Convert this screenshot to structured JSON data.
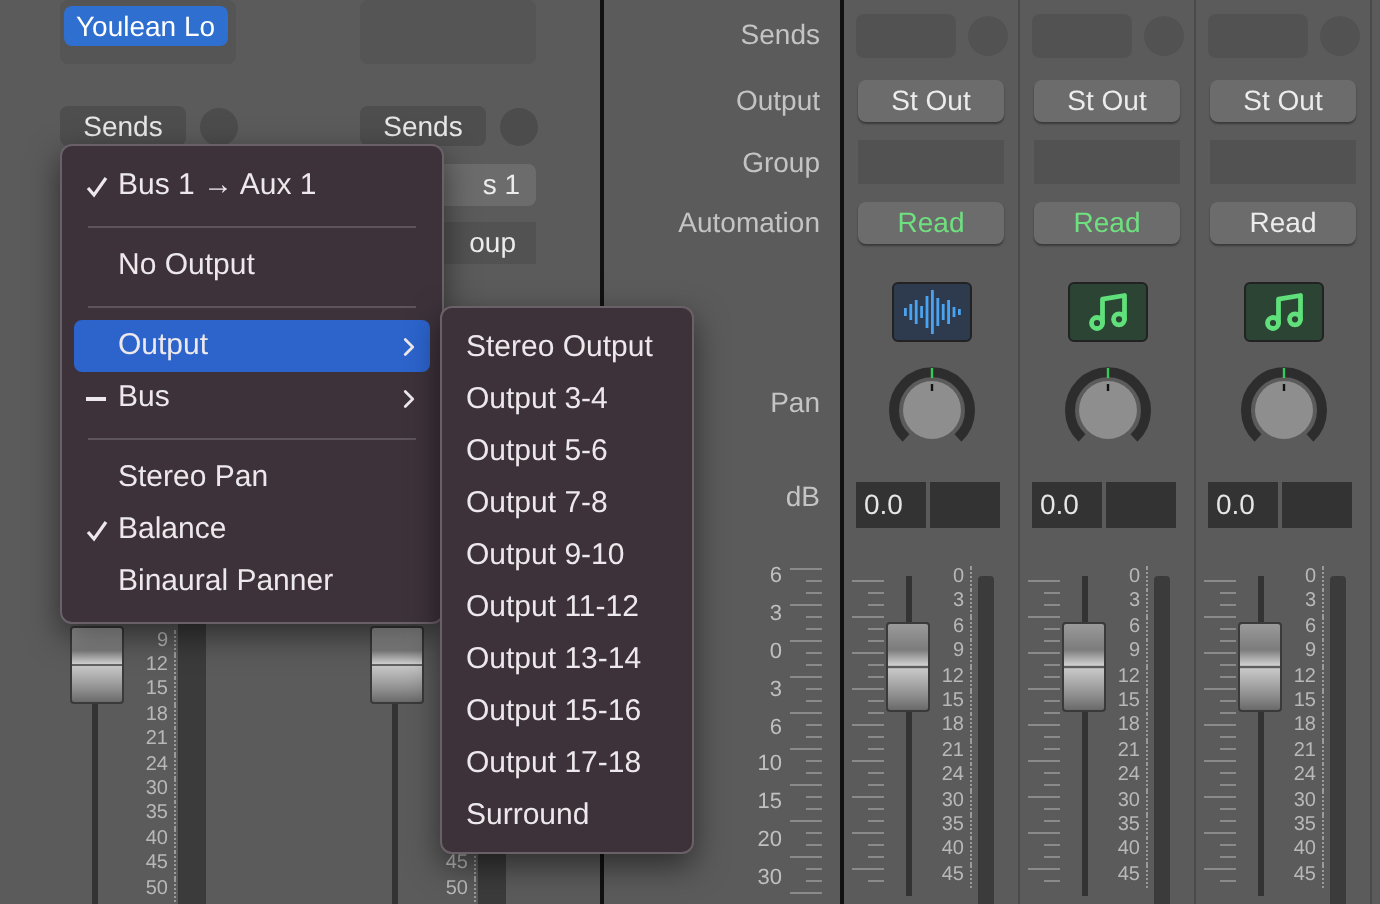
{
  "left_strips": [
    {
      "insert": {
        "label": "Youlean Lo"
      },
      "sends": "Sends",
      "scale": [
        "9",
        "12",
        "15",
        "18",
        "21",
        "24",
        "30",
        "35",
        "40",
        "45",
        "50"
      ]
    },
    {
      "sends": "Sends",
      "partial_controls": [
        {
          "kind": "button",
          "label": "s 1",
          "highlighted": false
        },
        {
          "kind": "slot",
          "label": "oup",
          "highlighted": false
        }
      ],
      "scale": [
        "45",
        "50"
      ]
    }
  ],
  "rows": [
    {
      "kind": "sends",
      "label": "Sends"
    },
    {
      "kind": "output",
      "label": "Output"
    },
    {
      "kind": "group",
      "label": "Group"
    },
    {
      "kind": "automation",
      "label": "Automation"
    },
    {
      "kind": "icon"
    },
    {
      "kind": "pan",
      "label": "Pan"
    },
    {
      "kind": "db",
      "label": "dB"
    }
  ],
  "row_scale": [
    "6",
    "3",
    "0",
    "3",
    "6",
    "10",
    "15",
    "20",
    "30"
  ],
  "channels": [
    {
      "output": "St Out",
      "automation": "Read",
      "automation_highlighted": true,
      "kind": "audio",
      "db": "0.0",
      "scale": [
        "0",
        "3",
        "6",
        "9",
        "12",
        "15",
        "18",
        "21",
        "24",
        "30",
        "35",
        "40",
        "45"
      ]
    },
    {
      "output": "St Out",
      "automation": "Read",
      "automation_highlighted": true,
      "kind": "instrument",
      "db": "0.0",
      "scale": [
        "0",
        "3",
        "6",
        "9",
        "12",
        "15",
        "18",
        "21",
        "24",
        "30",
        "35",
        "40",
        "45"
      ]
    },
    {
      "output": "St Out",
      "automation": "Read",
      "automation_highlighted": false,
      "kind": "instrument",
      "db": "0.0",
      "scale": [
        "0",
        "3",
        "6",
        "9",
        "12",
        "15",
        "18",
        "21",
        "24",
        "30",
        "35",
        "40",
        "45"
      ]
    }
  ],
  "menu": {
    "items": [
      {
        "kind": "item",
        "label": "Bus 1 → Aux 1",
        "checked": true,
        "mixed": false,
        "selected": false,
        "submenu": false
      },
      {
        "kind": "separator"
      },
      {
        "kind": "item",
        "label": "No Output",
        "checked": false,
        "mixed": false,
        "selected": false,
        "submenu": false
      },
      {
        "kind": "separator"
      },
      {
        "kind": "item",
        "label": "Output",
        "checked": false,
        "mixed": false,
        "selected": true,
        "submenu": true
      },
      {
        "kind": "item",
        "label": "Bus",
        "checked": false,
        "mixed": true,
        "selected": false,
        "submenu": true
      },
      {
        "kind": "separator"
      },
      {
        "kind": "item",
        "label": "Stereo Pan",
        "checked": false,
        "mixed": false,
        "selected": false,
        "submenu": false
      },
      {
        "kind": "item",
        "label": "Balance",
        "checked": true,
        "mixed": false,
        "selected": false,
        "submenu": false
      },
      {
        "kind": "item",
        "label": "Binaural Panner",
        "checked": false,
        "mixed": false,
        "selected": false,
        "submenu": false
      }
    ]
  },
  "submenu": {
    "items": [
      {
        "label": "Stereo Output"
      },
      {
        "label": "Output 3-4"
      },
      {
        "label": "Output 5-6"
      },
      {
        "label": "Output 7-8"
      },
      {
        "label": "Output 9-10"
      },
      {
        "label": "Output 11-12"
      },
      {
        "label": "Output 13-14"
      },
      {
        "label": "Output 15-16"
      },
      {
        "label": "Output 17-18"
      },
      {
        "label": "Surround"
      }
    ]
  }
}
